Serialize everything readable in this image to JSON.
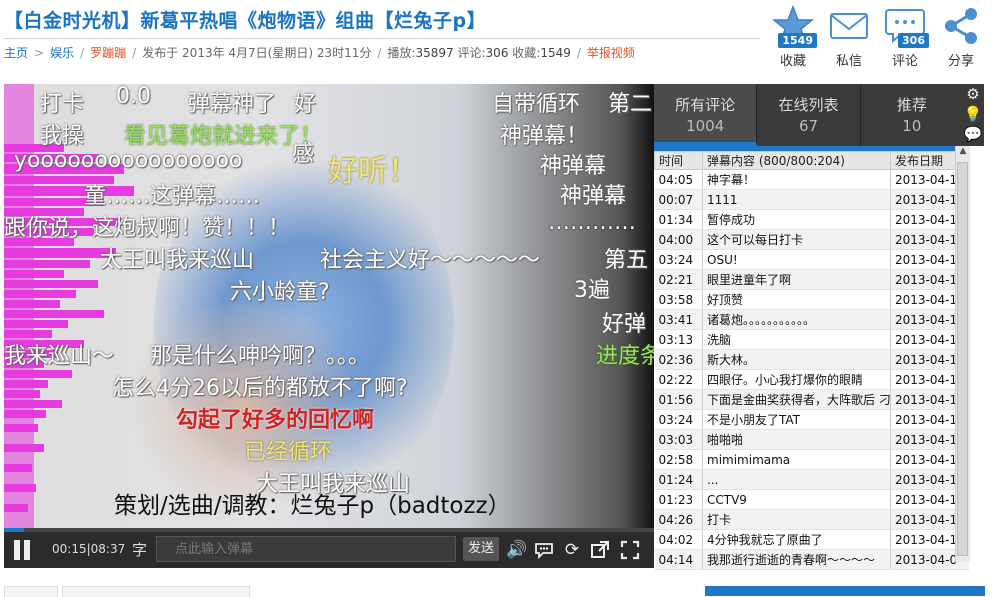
{
  "header": {
    "title": "【白金时光机】新葛平热唱《炮物语》组曲【烂兔子p】",
    "breadcrumb": [
      "主页",
      "娱乐"
    ],
    "uploader": "罗蹦蹦",
    "published_prefix": "发布于",
    "published": "2013年 4月7日(星期日) 23时11分",
    "plays_label": "播放:",
    "plays": "35897",
    "comments_label": "评论:",
    "comments": "306",
    "favorites_label": "收藏:",
    "favorites": "1549",
    "report": "举报视频"
  },
  "actions": [
    {
      "icon": "star-icon",
      "label": "收藏",
      "badge": "1549"
    },
    {
      "icon": "envelope-icon",
      "label": "私信",
      "badge": ""
    },
    {
      "icon": "chat-bubble-icon",
      "label": "评论",
      "badge": "306"
    },
    {
      "icon": "share-icon",
      "label": "分享",
      "badge": ""
    }
  ],
  "player": {
    "danmaku": [
      "打卡",
      "0.0",
      "弹幕神了",
      "好",
      "自带循环",
      "第二",
      "我操",
      "看见葛炮就进来了！",
      "神弹幕！",
      "感",
      "yoooooooooooooooo",
      "好听！",
      "神弹幕",
      "童……这弹幕……",
      "神弹幕",
      "跟你说，这炮叔啊！赞！！！",
      "…………",
      "太王叫我来巡山",
      "社会主义好～～～～～",
      "第五",
      "六小龄童?",
      "3遍",
      "好弹",
      "我来巡山～",
      "那是什么呻吟啊？。。。",
      "进度条",
      "怎么4分26以后的都放不了啊?",
      "勾起了好多的回忆啊",
      "已经循环",
      "大王叫我来巡山"
    ],
    "credit": "策划/选曲/调教：烂兔子p（badtozz）",
    "progress": 0.03,
    "time": "00:15|08:37",
    "input_label": "字",
    "input_placeholder": "点此输入弹幕",
    "send_label": "发送"
  },
  "panel": {
    "tabs": [
      {
        "label": "所有评论",
        "count": "1004"
      },
      {
        "label": "在线列表",
        "count": "67"
      },
      {
        "label": "推荐",
        "count": "10"
      }
    ],
    "columns": [
      "时间",
      "弹幕内容 (800/800:204)",
      "发布日期"
    ],
    "rows": [
      [
        "04:05",
        "神字幕！",
        "2013-04-1"
      ],
      [
        "00:07",
        "1111",
        "2013-04-1"
      ],
      [
        "01:34",
        "暂停成功",
        "2013-04-1"
      ],
      [
        "04:00",
        "这个可以每日打卡",
        "2013-04-1"
      ],
      [
        "03:24",
        "OSU!",
        "2013-04-1"
      ],
      [
        "02:21",
        "眼里进童年了啊",
        "2013-04-1"
      ],
      [
        "03:58",
        "好顶赞",
        "2013-04-1"
      ],
      [
        "03:41",
        "诸葛炮。。。。。。。。。。。",
        "2013-04-1"
      ],
      [
        "03:13",
        "洗脑",
        "2013-04-1"
      ],
      [
        "02:36",
        "斯大林。",
        "2013-04-1"
      ],
      [
        "02:22",
        "四眼仔。小心我打爆你的眼睛",
        "2013-04-1"
      ],
      [
        "01:56",
        "下面是金曲奖获得者，大阵歌后 刁",
        "2013-04-1"
      ],
      [
        "03:24",
        "不是小朋友了TAT",
        "2013-04-1"
      ],
      [
        "03:03",
        "啪啪啪",
        "2013-04-1"
      ],
      [
        "02:58",
        "mimimimama",
        "2013-04-1"
      ],
      [
        "01:24",
        "...",
        "2013-04-1"
      ],
      [
        "01:23",
        "CCTV9",
        "2013-04-1"
      ],
      [
        "04:26",
        "打卡",
        "2013-04-1"
      ],
      [
        "04:02",
        "4分钟我就忘了原曲了",
        "2013-04-1"
      ],
      [
        "04:14",
        "我那逝行逝逝的青春啊～～～～",
        "2013-04-0"
      ]
    ]
  },
  "colors": {
    "accent": "#1e78c8",
    "warn": "#e0542b",
    "magenta": "#e73ae0"
  }
}
